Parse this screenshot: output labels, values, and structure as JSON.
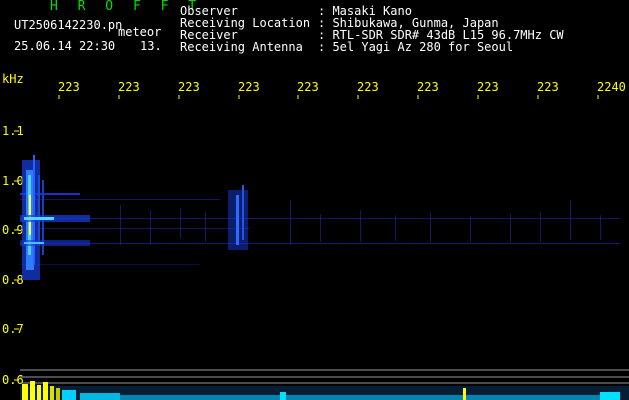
{
  "header": {
    "brand": "H R O F F T",
    "filename": "UT2506142230.pn",
    "tag": "meteor",
    "datetime": "25.06.14 22:30",
    "count": "13.",
    "fields": [
      {
        "label": "Observer",
        "value": ": Masaki Kano"
      },
      {
        "label": "Receiving Location",
        "value": ": Shibukawa, Gunma, Japan"
      },
      {
        "label": "Receiver",
        "value": ": RTL-SDR SDR# 43dB L15 96.7MHz CW"
      },
      {
        "label": "Receiving Antenna",
        "value": ": 5el Yagi Az 280 for Seoul"
      }
    ]
  },
  "axis": {
    "y_unit": "kHz",
    "y_ticks": [
      "1.1",
      "1.0",
      "0.9",
      "0.8",
      "0.7",
      "0.6"
    ],
    "x_ticks": [
      "223",
      "223",
      "223",
      "223",
      "223",
      "223",
      "223",
      "223",
      "223",
      "2240"
    ]
  },
  "colors": {
    "text_label": "#ffffff",
    "text_tick": "#ffff00",
    "brand": "#00e000",
    "signal": "#3355ff",
    "intensity_low": "#00ffff",
    "intensity_high": "#ffff00"
  }
}
